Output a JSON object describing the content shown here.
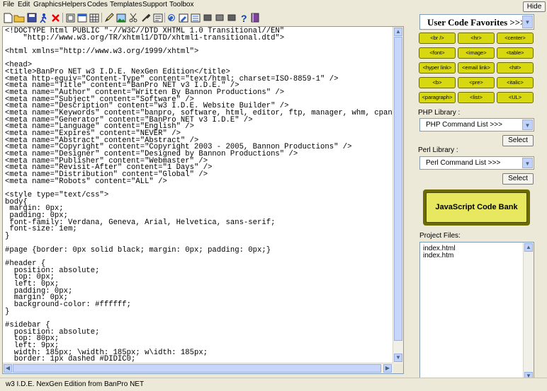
{
  "menubar": {
    "items": [
      "File",
      "Edit",
      "Graphics",
      "Helpers",
      "Codes",
      "Templates",
      "Support",
      "Toolbox"
    ],
    "hide_label": "Hide"
  },
  "toolbar": {
    "icons": [
      "new-file-icon",
      "open-folder-icon",
      "save-icon",
      "run-icon",
      "delete-icon",
      "frame-icon",
      "window-icon",
      "table-icon",
      "pencil-icon",
      "image-icon",
      "cut-icon",
      "tools-icon",
      "text-icon",
      "refresh-icon",
      "edit-icon",
      "list-icon",
      "block-icon",
      "block2-icon",
      "block3-icon",
      "help-icon",
      "book-icon"
    ]
  },
  "editor": {
    "code": "<!DOCTYPE html PUBLIC \"-//W3C//DTD XHTML 1.0 Transitional//EN\"\n    \"http://www.w3.org/TR/xhtml1/DTD/xhtml1-transitional.dtd\">\n\n<html xmlns=\"http://www.w3.org/1999/xhtml\">\n\n<head>\n<title>BanPro NET w3 I.D.E. NexGen Edition</title>\n<meta http-equiv=\"Content-Type\" content=\"text/html; charset=ISO-8859-1\" />\n<meta name=\"Title\" content=\"BanPro NET v3 I.D.E.\" />\n<meta name=\"Author\" content=\"Written By Bannon Productions\" />\n<meta name=\"Subject\" content=\"Software\" />\n<meta name=\"Description\" content=\"w3 I.D.E. Website Builder\" />\n<meta name=\"Keywords\" content=\"banpro, software, html, editor, ftp, manager, whm, cpanel, l\n<meta name=\"Generator\" content=\"BanPro NET v3 I.D.E\" />\n<meta name=\"Language\" content=\"English\" />\n<meta name=\"Expires\" content=\"NEVER\" />\n<meta name=\"Abstract\" content=\"Abstract\" />\n<meta name=\"Copyright\" content=\"Copyright 2003 - 2005, Bannon Productions\" />\n<meta name=\"Designer\" content=\"Designed by Bannon Productions\" />\n<meta name=\"Publisher\" content=\"Webmaster\" />\n<meta name=\"Revisit-After\" content=\"1 Days\" />\n<meta name=\"Distribution\" content=\"Global\" />\n<meta name=\"Robots\" content=\"ALL\" />\n\n<style type=\"text/css\">\nbody{\n margin: 0px;\n padding: 0px;\n font-family: Verdana, Geneva, Arial, Helvetica, sans-serif;\n font-size: 1em;\n}\n\n#page {border: 0px solid black; margin: 0px; padding: 0px;}\n\n#header {\n  position: absolute;\n  top: 0px;\n  left: 0px;\n  padding: 0px;\n  margin: 0px;\n  background-color: #ffffff;\n}\n\n#sidebar {\n  position: absolute;\n  top: 80px;\n  left: 9px;\n  width: 185px; \\width: 185px; w\\idth: 185px;\n  border: 1px dashed #DIDIC0;"
  },
  "favorites": {
    "label": "User Code Favorites  >>>",
    "buttons": [
      "<br />",
      "<hr>",
      "<center>",
      "<font>",
      "<image>",
      "<table>",
      "<hyper link>",
      "<email link>",
      "<h#>",
      "<b>",
      "<pre>",
      "<italic>",
      "<paragraph>",
      "<list>",
      "<UL>"
    ]
  },
  "php": {
    "label": "PHP Library :",
    "selected": "PHP Command List  >>>",
    "select_label": "Select"
  },
  "perl": {
    "label": "Perl Library :",
    "selected": "Perl Command List  >>>",
    "select_label": "Select"
  },
  "js_bank_label": "JavaScript Code Bank",
  "project": {
    "label": "Project Files:",
    "files": [
      "index.html",
      "index.htm"
    ]
  },
  "status": "w3 I.D.E. NexGen Edition from  BanPro NET",
  "colors": {
    "favorite_button": "#d8d810",
    "js_bank_border": "#6b6b00",
    "scroll_blue": "#c1d3fb"
  }
}
